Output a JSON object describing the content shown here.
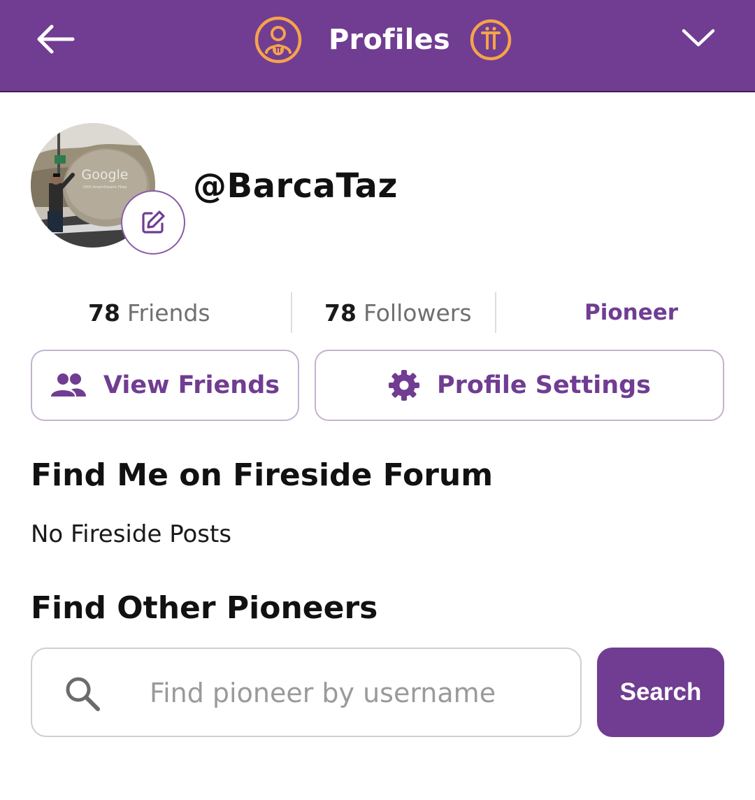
{
  "header": {
    "title": "Profiles",
    "back_icon": "arrow-left-icon",
    "profile_icon": "profile-badge-icon",
    "pi_icon": "pi-coin-icon",
    "menu_icon": "chevron-down-icon",
    "background_color": "#703d92",
    "icon_accent_color": "#f5a34b"
  },
  "profile": {
    "username": "@BarcaTaz",
    "avatar_sign_text": "Google",
    "avatar_sign_subtext": "1600 Amphitheatre Pkwy",
    "edit_icon": "pencil-edit-icon"
  },
  "stats": {
    "friends_count": "78",
    "friends_label": "Friends",
    "followers_count": "78",
    "followers_label": "Followers",
    "role": "Pioneer"
  },
  "actions": {
    "view_friends_label": "View Friends",
    "view_friends_icon": "people-icon",
    "profile_settings_label": "Profile Settings",
    "profile_settings_icon": "gear-icon"
  },
  "fireside": {
    "heading": "Find Me on Fireside Forum",
    "empty_text": "No Fireside Posts"
  },
  "find_pioneers": {
    "heading": "Find Other Pioneers",
    "search_placeholder": "Find pioneer by username",
    "search_value": "",
    "search_button_label": "Search",
    "search_icon": "search-icon"
  },
  "accent_color": "#703d92"
}
